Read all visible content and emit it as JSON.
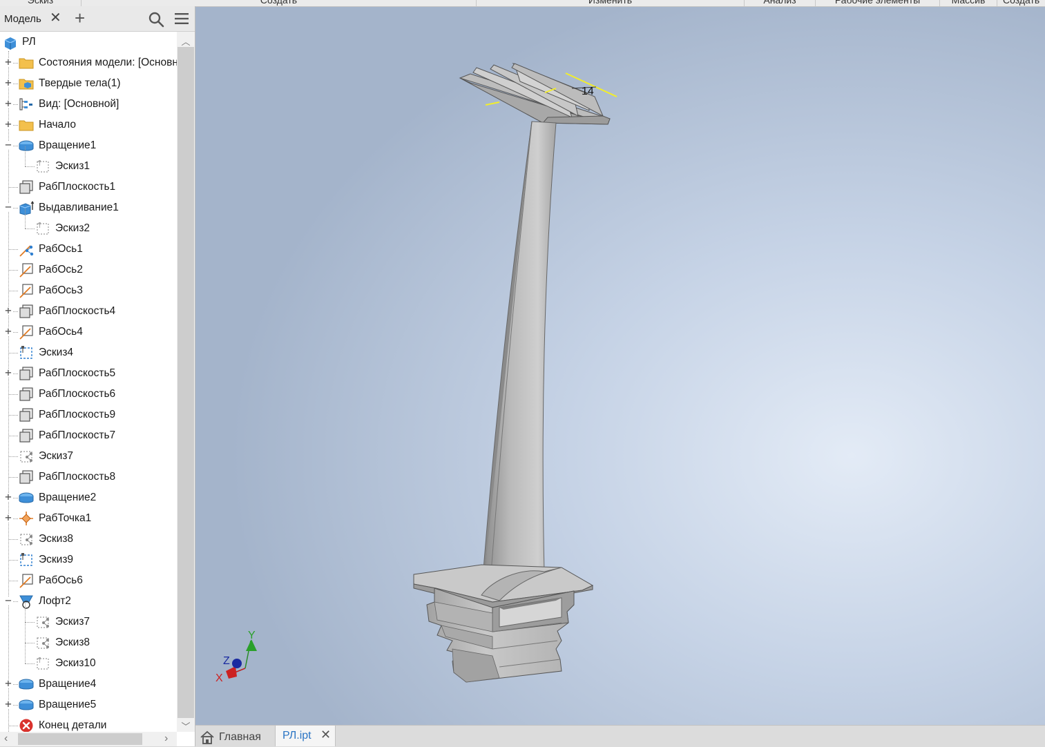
{
  "ribbon": {
    "groups": [
      "Эскиз",
      "Создать",
      "Изменить",
      "Анализ",
      "Рабочие элементы",
      "Массив",
      "Создать"
    ]
  },
  "browser": {
    "tab_label": "Модель",
    "close_glyph": "✕",
    "add_glyph": "+",
    "root": {
      "label": "РЛ",
      "icon": "part-cube-icon"
    },
    "items": [
      {
        "label": "Состояния модели: [Основной]",
        "icon": "folder-icon",
        "expander": "+"
      },
      {
        "label": "Твердые тела(1)",
        "icon": "solid-bodies-folder-icon",
        "expander": "+"
      },
      {
        "label": "Вид: [Основной]",
        "icon": "view-rep-icon",
        "expander": "+"
      },
      {
        "label": "Начало",
        "icon": "folder-icon",
        "expander": "+"
      },
      {
        "label": "Вращение1",
        "icon": "revolve-icon",
        "expander": "−"
      },
      {
        "label": "Эскиз1",
        "icon": "sketch-icon",
        "child": true
      },
      {
        "label": "РабПлоскость1",
        "icon": "work-plane-icon"
      },
      {
        "label": "Выдавливание1",
        "icon": "extrude-icon",
        "expander": "−"
      },
      {
        "label": "Эскиз2",
        "icon": "sketch-icon",
        "child": true
      },
      {
        "label": "РабОсь1",
        "icon": "work-axis-shared-icon"
      },
      {
        "label": "РабОсь2",
        "icon": "work-axis-icon"
      },
      {
        "label": "РабОсь3",
        "icon": "work-axis-icon"
      },
      {
        "label": "РабПлоскость4",
        "icon": "work-plane-icon",
        "expander": "+"
      },
      {
        "label": "РабОсь4",
        "icon": "work-axis-icon",
        "expander": "+"
      },
      {
        "label": "Эскиз4",
        "icon": "sketch-blue-icon"
      },
      {
        "label": "РабПлоскость5",
        "icon": "work-plane-icon",
        "expander": "+"
      },
      {
        "label": "РабПлоскость6",
        "icon": "work-plane-icon"
      },
      {
        "label": "РабПлоскость9",
        "icon": "work-plane-icon"
      },
      {
        "label": "РабПлоскость7",
        "icon": "work-plane-icon"
      },
      {
        "label": "Эскиз7",
        "icon": "sketch-shared-icon"
      },
      {
        "label": "РабПлоскость8",
        "icon": "work-plane-icon"
      },
      {
        "label": "Вращение2",
        "icon": "revolve-icon",
        "expander": "+"
      },
      {
        "label": "РабТочка1",
        "icon": "work-point-icon",
        "expander": "+"
      },
      {
        "label": "Эскиз8",
        "icon": "sketch-shared-icon"
      },
      {
        "label": "Эскиз9",
        "icon": "sketch-blue-icon"
      },
      {
        "label": "РабОсь6",
        "icon": "work-axis-icon"
      },
      {
        "label": "Лофт2",
        "icon": "loft-icon",
        "expander": "−"
      },
      {
        "label": "Эскиз7",
        "icon": "sketch-shared-icon",
        "child": true
      },
      {
        "label": "Эскиз8",
        "icon": "sketch-shared-icon",
        "child": true
      },
      {
        "label": "Эскиз10",
        "icon": "sketch-icon",
        "child": true
      },
      {
        "label": "Вращение4",
        "icon": "revolve-icon",
        "expander": "+"
      },
      {
        "label": "Вращение5",
        "icon": "revolve-icon",
        "expander": "+"
      },
      {
        "label": "Конец детали",
        "icon": "end-of-part-icon"
      }
    ]
  },
  "viewport": {
    "dimension_label": "14",
    "triad": {
      "x": "X",
      "y": "Y",
      "z": "Z"
    }
  },
  "doc_tabs": {
    "home_label": "Главная",
    "active_label": "РЛ.ipt",
    "close_glyph": "✕"
  },
  "colors": {
    "accent": "#2a74c4",
    "folder": "#f3c04d",
    "feature_blue": "#3e8fd8",
    "end_red": "#d9322d",
    "dimension_yellow": "#f2ee2a"
  }
}
